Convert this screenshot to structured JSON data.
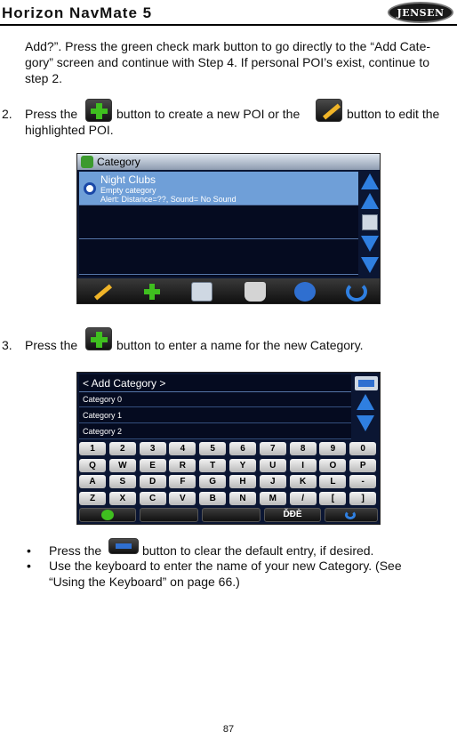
{
  "header": {
    "title": "Horizon NavMate 5",
    "logo_text": "JENSEN"
  },
  "intro": {
    "line1": "Add?”. Press the green check mark button to go directly to the “Add Cate-",
    "line2": "gory” screen and continue with Step 4. If personal POI’s exist, continue to",
    "line3": "step 2."
  },
  "step2": {
    "number": "2.",
    "text_a": "Press the",
    "text_b": "button to create a new POI or the",
    "text_c": "button to edit the",
    "text_d": "highlighted POI."
  },
  "screen1": {
    "title": "Category",
    "rows": [
      {
        "name": "Night Clubs",
        "sub1": "Empty category",
        "sub2": "Alert: Distance=??, Sound= No Sound"
      }
    ],
    "icons": [
      "edit-pencil-icon",
      "add-plus-icon",
      "list-icon",
      "trash-icon",
      "options-icon",
      "back-arrow-icon"
    ]
  },
  "step3": {
    "number": "3.",
    "text_a": "Press the",
    "text_b": "button to enter a name for the new Category."
  },
  "screen2": {
    "title": "< Add Category >",
    "categories": [
      "Category 0",
      "Category 1",
      "Category 2"
    ],
    "keys": [
      [
        "1",
        "2",
        "3",
        "4",
        "5",
        "6",
        "7",
        "8",
        "9",
        "0"
      ],
      [
        "Q",
        "W",
        "E",
        "R",
        "T",
        "Y",
        "U",
        "I",
        "O",
        "P"
      ],
      [
        "A",
        "S",
        "D",
        "F",
        "G",
        "H",
        "J",
        "K",
        "L",
        "-"
      ],
      [
        "Z",
        "X",
        "C",
        "V",
        "B",
        "N",
        "M",
        "/",
        "[",
        "]"
      ]
    ],
    "accent_key": "ĎĐÈ"
  },
  "bullets": [
    {
      "mark": "•",
      "text_a": "Press the",
      "text_b": "button to clear the default entry, if desired."
    },
    {
      "mark": "•",
      "text_a": "Use the keyboard to enter the name of your new Category. (See",
      "text_b": "“Using the Keyboard” on page 66.)"
    }
  ],
  "page_number": "87",
  "colors": {
    "accent_blue": "#2f7fe0",
    "highlight_blue": "#6f9fd8",
    "plus_green": "#3fbf1f",
    "screen_bg": "#0b1633"
  }
}
